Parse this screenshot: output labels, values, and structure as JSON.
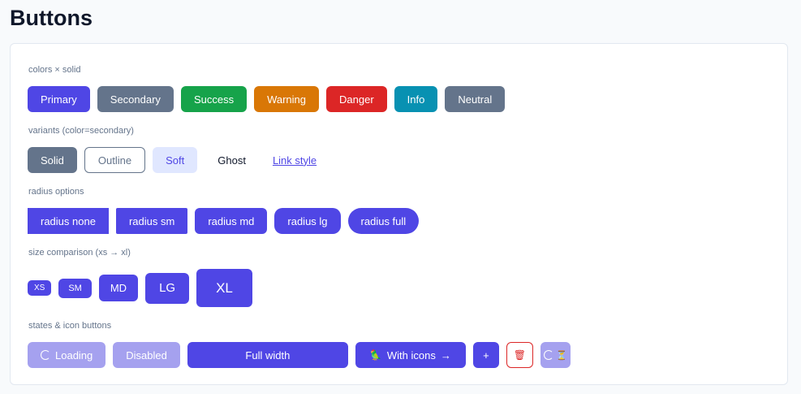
{
  "page_title": "Buttons",
  "sections": {
    "colors_label": "colors × solid",
    "variants_label": "variants (color=secondary)",
    "radius_label": "radius options",
    "size_label": "size comparison (xs → xl)",
    "states_label": "states & icon buttons"
  },
  "colors": {
    "primary": "Primary",
    "secondary": "Secondary",
    "success": "Success",
    "warning": "Warning",
    "danger": "Danger",
    "info": "Info",
    "neutral": "Neutral"
  },
  "variants": {
    "solid": "Solid",
    "outline": "Outline",
    "soft": "Soft",
    "ghost": "Ghost",
    "link": "Link style"
  },
  "radius": {
    "none": "radius none",
    "sm": "radius sm",
    "md": "radius md",
    "lg": "radius lg",
    "full": "radius full"
  },
  "sizes": {
    "xs": "XS",
    "sm": "SM",
    "md": "MD",
    "lg": "LG",
    "xl": "XL"
  },
  "states": {
    "loading": "Loading",
    "disabled": "Disabled",
    "full_width": "Full width",
    "with_icons": "With icons",
    "plus": "+",
    "with_icons_leading_icon": "🦜",
    "with_icons_trailing_icon": "→",
    "delete_icon": "🗑",
    "hourglass_icon": "⏳"
  },
  "theme_colors": {
    "primary": "#4f46e5",
    "secondary": "#64748b",
    "success": "#16a34a",
    "warning": "#d97706",
    "danger": "#dc2626",
    "info": "#0891b2",
    "neutral": "#64748b"
  }
}
